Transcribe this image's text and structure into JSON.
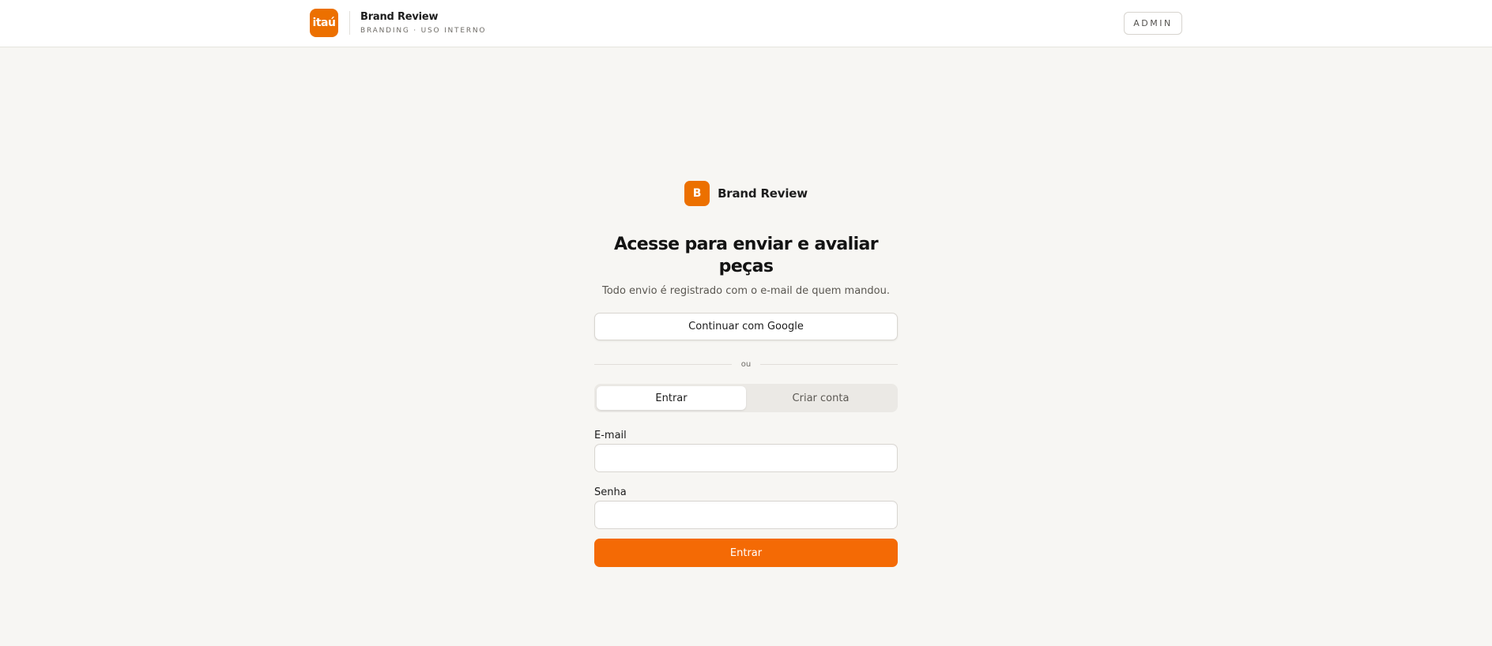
{
  "header": {
    "logo_text": "itaú",
    "title": "Brand Review",
    "subtitle": "BRANDING · USO INTERNO",
    "admin_label": "ADMIN"
  },
  "app": {
    "mark": "B",
    "name": "Brand Review"
  },
  "login": {
    "headline": "Acesse para enviar e avaliar peças",
    "subline": "Todo envio é registrado com o e-mail de quem mandou.",
    "google_label": "Continuar com Google",
    "divider_label": "ou",
    "tabs": [
      {
        "label": "Entrar",
        "active": true
      },
      {
        "label": "Criar conta",
        "active": false
      }
    ],
    "email_label": "E-mail",
    "email_value": "",
    "password_label": "Senha",
    "password_value": "",
    "submit_label": "Entrar"
  },
  "colors": {
    "brand_orange": "#ec7000",
    "button_orange": "#f46a05",
    "background": "#f7f6f3"
  }
}
